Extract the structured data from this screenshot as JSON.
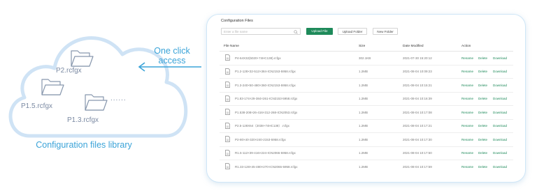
{
  "library": {
    "caption": "Configuration files library",
    "files": [
      "P2.rcfgx",
      "P1.5.rcfgx",
      "P1.3.rcfgx"
    ],
    "ellipsis": "......"
  },
  "access_label": "One click access",
  "panel": {
    "title": "Configuration Files",
    "search_placeholder": "Enter a file name",
    "buttons": {
      "upload_file": "Upload File",
      "upload_folder": "Upload Folder",
      "new_folder": "New Folder"
    },
    "columns": {
      "name": "File Name",
      "size": "Size",
      "date": "Date Modified",
      "action": "Action"
    },
    "rows": [
      {
        "name": "P4-64X32(5020+74HC138).rcfgx",
        "size": "302.1KB",
        "date": "2021-07-30 15:20:12"
      },
      {
        "name": "P1.2-128×32-512×384-ICN2153-5958.rcfgx",
        "size": "1.2MB",
        "date": "2021-08-04 10:09:23"
      },
      {
        "name": "P1.3-240×50-480×360-ICN2153-5958.rcfgx",
        "size": "1.2MB",
        "date": "2021-08-04 10:15:21"
      },
      {
        "name": "P1.83-174×29-384×261-ICN2153-5958.rcfgx",
        "size": "1.2MB",
        "date": "2021-08-04 10:16:39"
      },
      {
        "name": "P1.538-208×26-416×312-268-ICN2053.rcfgx",
        "size": "1.2MB",
        "date": "2021-08-04 10:17:08"
      },
      {
        "name": "P2.5-128X64（2038+74HC138）.rcfgx",
        "size": "1.2MB",
        "date": "2021-08-04 10:17:21"
      },
      {
        "name": "P2-80×40-320×240-2153-5958.rcfgx",
        "size": "1.2MB",
        "date": "2021-08-04 10:17:30"
      },
      {
        "name": "R1.5-112×39-416×224-ICN2065-5958.rcfgx",
        "size": "1.2MB",
        "date": "2021-08-04 10:17:50"
      },
      {
        "name": "R1.33-128×45-480×270-ICN2065-5958.rcfgx",
        "size": "1.2MB",
        "date": "2021-08-04 10:17:59"
      }
    ],
    "actions": {
      "rename": "Rename",
      "delete": "Delete",
      "download": "Download"
    }
  }
}
